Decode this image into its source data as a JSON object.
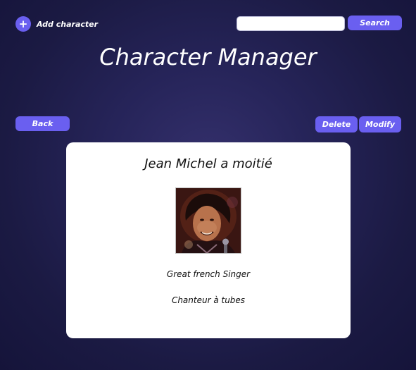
{
  "header": {
    "add_character_label": "Add character",
    "search_placeholder": "",
    "search_button": "Search",
    "title": "Character Manager"
  },
  "actions": {
    "back": "Back",
    "delete": "Delete",
    "modify": "Modify"
  },
  "character": {
    "name": "Jean Michel a moitié",
    "description": "Great french Singer",
    "subtitle": "Chanteur à tubes"
  },
  "colors": {
    "accent": "#6a5ff0",
    "background": "#262459",
    "card": "#ffffff"
  },
  "icons": {
    "add": "plus-icon"
  }
}
